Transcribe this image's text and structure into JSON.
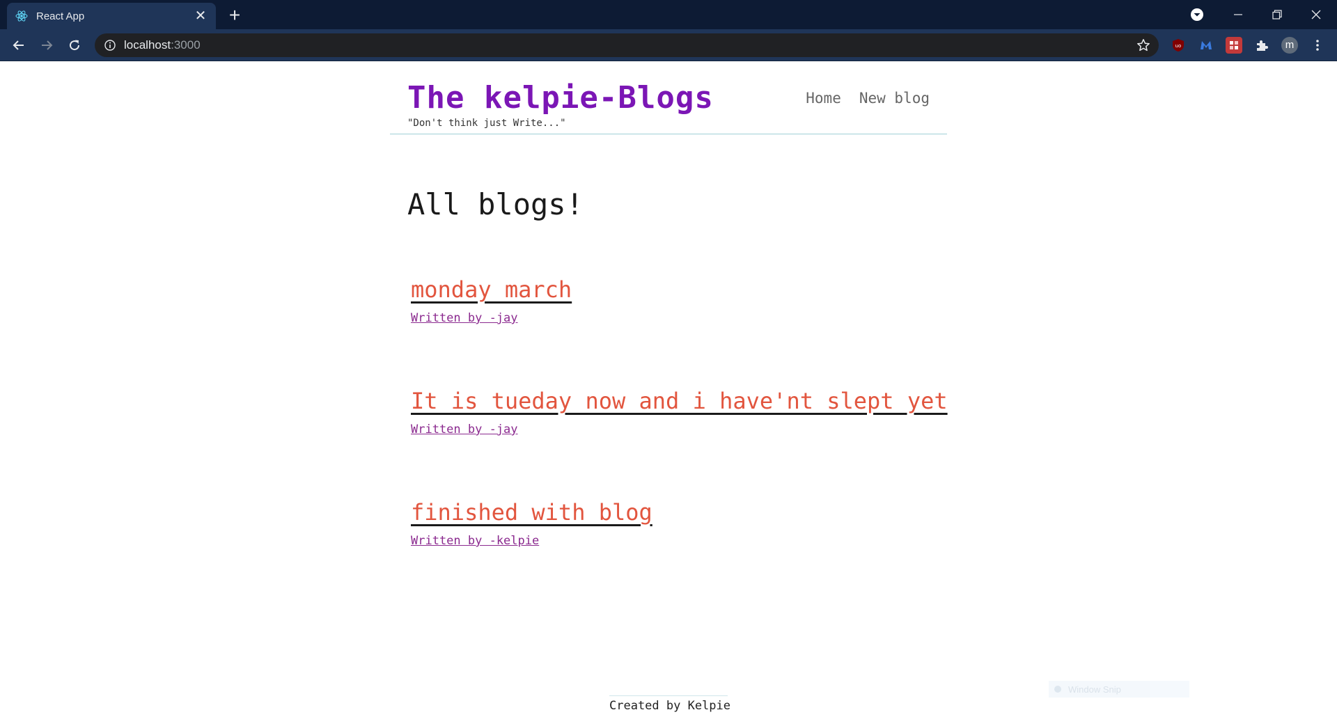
{
  "browser": {
    "tab": {
      "title": "React App",
      "favicon": "react-icon",
      "close": "✕"
    },
    "new_tab": "+",
    "url": {
      "host": "localhost",
      "port": ":3000"
    },
    "profile_initial": "m"
  },
  "site": {
    "title": "The kelpie-Blogs",
    "tagline": "\"Don't think just Write...\"",
    "nav": [
      {
        "label": "Home"
      },
      {
        "label": "New blog"
      }
    ]
  },
  "main": {
    "heading": "All blogs!",
    "blogs": [
      {
        "title": "monday march",
        "author": "Written by -jay"
      },
      {
        "title": "It is tueday now and i have'nt slept yet",
        "author": "Written by -jay"
      },
      {
        "title": "finished with blog",
        "author": "Written by -kelpie"
      }
    ]
  },
  "footer": {
    "text": "Created by Kelpie"
  },
  "overlay": {
    "snip_label": "Window Snip"
  },
  "colors": {
    "title": "#7b16b5",
    "blog_title": "#e2553e",
    "author": "#8b2a8f",
    "chrome_dark": "#0d1b34",
    "chrome_tab": "#1f3558"
  }
}
